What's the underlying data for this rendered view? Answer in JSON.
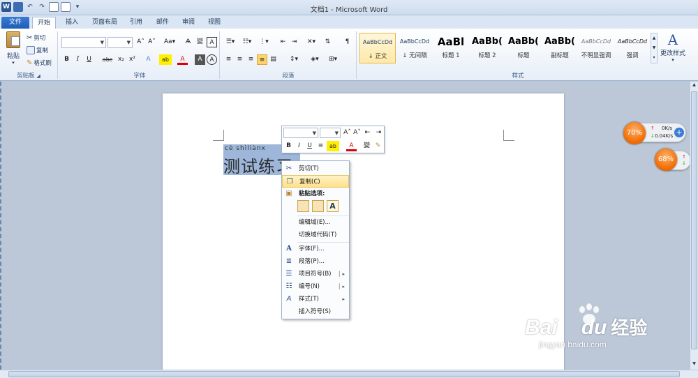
{
  "window": {
    "title": "文档1 - Microsoft Word"
  },
  "qat": {
    "undo_arrow": "↶",
    "redo_arrow": "↷"
  },
  "tabs": [
    {
      "label": "文件"
    },
    {
      "label": "开始"
    },
    {
      "label": "插入"
    },
    {
      "label": "页面布局"
    },
    {
      "label": "引用"
    },
    {
      "label": "邮件"
    },
    {
      "label": "审阅"
    },
    {
      "label": "视图"
    }
  ],
  "clipboard": {
    "paste": "粘贴",
    "cut": "剪切",
    "copy": "复制",
    "format_painter": "格式刷",
    "group": "剪贴板"
  },
  "font": {
    "group": "字体",
    "font_name": "",
    "font_size": "",
    "bold": "B",
    "italic": "I",
    "underline": "U",
    "strike": "abc",
    "sub": "x₂",
    "sup": "x²",
    "aa": "Aa▾",
    "grow": "A˄",
    "shrink": "A˅",
    "phonetic": "wén",
    "charborder": "A",
    "fontcolor": "A",
    "highlight": "ab",
    "charshade": "A",
    "ruby": "變",
    "clear": "Ѧ"
  },
  "paragraph": {
    "group": "段落"
  },
  "styles": {
    "group": "样式",
    "items": [
      {
        "sample": "AaBbCcDd",
        "name": "↓ 正文"
      },
      {
        "sample": "AaBbCcDd",
        "name": "↓ 无间隔"
      },
      {
        "sample": "AaBl",
        "name": "标题 1"
      },
      {
        "sample": "AaBb(",
        "name": "标题 2"
      },
      {
        "sample": "AaBb(",
        "name": "标题"
      },
      {
        "sample": "AaBb(",
        "name": "副标题"
      },
      {
        "sample": "AaBbCcDd",
        "name": "不明显强调"
      },
      {
        "sample": "AaBbCcDd",
        "name": "强调"
      }
    ],
    "change": "更改样式"
  },
  "document": {
    "pinyin": "cè shìliànx",
    "text": "测试练习"
  },
  "mini_toolbar": {
    "font_name": "",
    "font_size": ""
  },
  "context_menu": {
    "items": [
      {
        "label": "剪切(T)"
      },
      {
        "label": "复制(C)"
      },
      {
        "label": "粘贴选项:"
      },
      {
        "label": "编辑域(E)..."
      },
      {
        "label": "切换域代码(T)"
      },
      {
        "label": "字体(F)..."
      },
      {
        "label": "段落(P)..."
      },
      {
        "label": "项目符号(B)"
      },
      {
        "label": "编号(N)"
      },
      {
        "label": "样式(T)"
      },
      {
        "label": "插入符号(S)"
      }
    ]
  },
  "widgets": {
    "cpu": "70%",
    "up": "0K/s",
    "down": "0.04K/s",
    "mem": "68%"
  },
  "watermark": {
    "brand": "Bai",
    "brand2": "du",
    "cn": "经验",
    "url": "jingyan.baidu.com"
  }
}
